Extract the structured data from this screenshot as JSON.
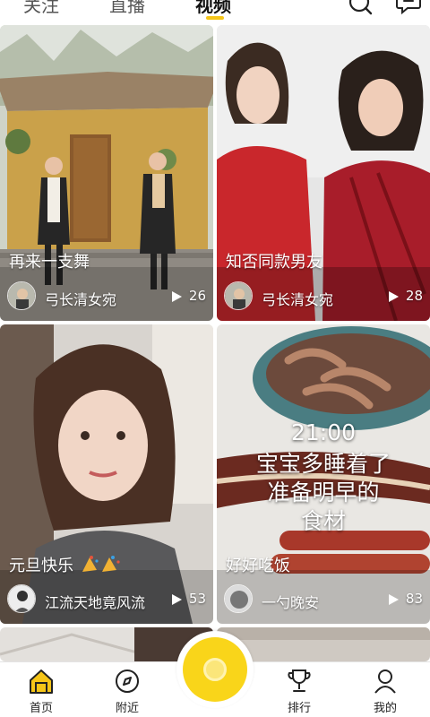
{
  "colors": {
    "accent": "#f5c518",
    "record_button": "#f9d51a"
  },
  "top_tabs": [
    {
      "label": "关注",
      "active": false
    },
    {
      "label": "直播",
      "active": false
    },
    {
      "label": "视频",
      "active": true
    }
  ],
  "top_icons": [
    "search-icon",
    "message-icon"
  ],
  "feed": [
    {
      "title": "再来一支舞",
      "author": "弓长清女宛",
      "plays": "26"
    },
    {
      "title": "知否同款男友",
      "author": "弓长清女宛",
      "plays": "28"
    },
    {
      "title": "元旦快乐",
      "author": "江流天地竟风流",
      "plays": "53"
    },
    {
      "title": "好好吃饭",
      "author": "一勺晚安",
      "plays": "83",
      "overlay": [
        "21:00",
        "宝宝多睡着了",
        "准备明早的",
        "食材"
      ]
    }
  ],
  "bottom_nav": [
    {
      "label": "首页",
      "icon": "home-icon",
      "active": true
    },
    {
      "label": "附近",
      "icon": "compass-icon",
      "active": false
    },
    {
      "label": "",
      "icon": "record-icon",
      "active": false
    },
    {
      "label": "排行",
      "icon": "trophy-icon",
      "active": false
    },
    {
      "label": "我的",
      "icon": "profile-icon",
      "active": false
    }
  ]
}
